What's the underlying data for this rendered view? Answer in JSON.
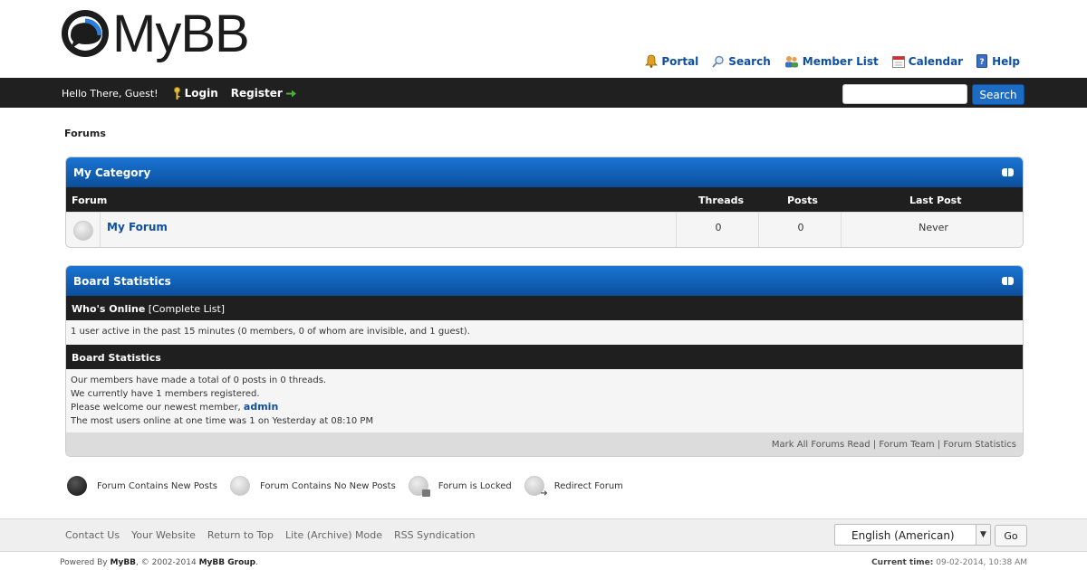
{
  "header": {
    "logo_text": "MyBB",
    "toplinks": [
      {
        "label": "Portal",
        "icon": "bell-icon"
      },
      {
        "label": "Search",
        "icon": "magnifier-icon"
      },
      {
        "label": "Member List",
        "icon": "users-icon"
      },
      {
        "label": "Calendar",
        "icon": "calendar-icon"
      },
      {
        "label": "Help",
        "icon": "help-book-icon"
      }
    ]
  },
  "navbar": {
    "greeting": "Hello There, Guest!",
    "login_label": "Login",
    "register_label": "Register",
    "search_value": "",
    "search_button": "Search"
  },
  "breadcrumb": "Forums",
  "category": {
    "title": "My Category",
    "columns": [
      "Forum",
      "Threads",
      "Posts",
      "Last Post"
    ],
    "rows": [
      {
        "forum": "My Forum",
        "threads": "0",
        "posts": "0",
        "last_post": "Never"
      }
    ]
  },
  "board_stats": {
    "title": "Board Statistics",
    "whos_online_label": "Who's Online",
    "complete_list_label": "[Complete List]",
    "online_text": "1 user active in the past 15 minutes (0 members, 0 of whom are invisible, and 1 guest).",
    "stats_heading": "Board Statistics",
    "line1": "Our members have made a total of 0 posts in 0 threads.",
    "line2": "We currently have 1 members registered.",
    "line3_prefix": "Please welcome our newest member,",
    "newest_member": "admin",
    "line4": "The most users online at one time was 1 on Yesterday at 08:10 PM",
    "foot_links": [
      "Mark All Forums Read",
      "Forum Team",
      "Forum Statistics"
    ],
    "separator": "|"
  },
  "legend": [
    "Forum Contains New Posts",
    "Forum Contains No New Posts",
    "Forum is Locked",
    "Redirect Forum"
  ],
  "footer": {
    "links": [
      "Contact Us",
      "Your Website",
      "Return to Top",
      "Lite (Archive) Mode",
      "RSS Syndication"
    ],
    "language": "English (American)",
    "go_label": "Go",
    "powered_prefix": "Powered By",
    "powered_by": "MyBB",
    "copyright_mid": ", © 2002-2014",
    "group": "MyBB Group",
    "period": ".",
    "current_time_label": "Current time:",
    "current_time": "09-02-2014, 10:38 AM"
  },
  "colors": {
    "brand_blue": "#0e4fa1",
    "header_bar": "#202020",
    "box_head": "#1a74d4"
  }
}
